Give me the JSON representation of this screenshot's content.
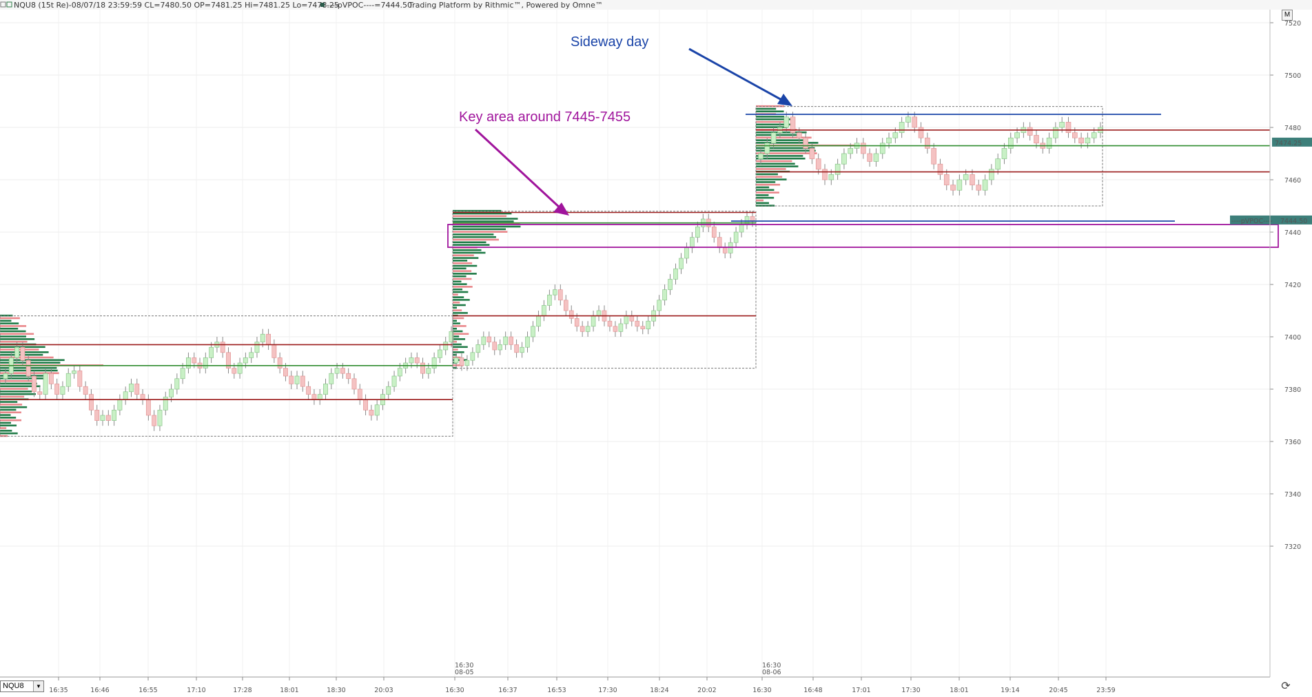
{
  "header": {
    "title": "NQU8 (15t Re)-08/07/18 23:59:59 CL=7480.50 OP=7481.25 Hi=7481.25 Lo=7478.25",
    "pvpoc_label": "----pVPOC----=7444.50",
    "platform": "Trading Platform by Rithmic™, Powered by Omne™"
  },
  "symbol_selector": {
    "value": "NQU8"
  },
  "m_button": "M",
  "annotations": {
    "sideway": "Sideway day",
    "key_area": "Key area around 7445-7455"
  },
  "price_tags": {
    "last": "7474.25",
    "pvpoc_text": "----pVPOC----",
    "pvpoc_value": "7444.50"
  },
  "time_axis": {
    "session_labels": [
      [
        "16:30",
        "08-05"
      ],
      [
        "16:30",
        "08-06"
      ]
    ]
  },
  "colors": {
    "bull": "#c9f0c6",
    "bear": "#f4c2c2",
    "volume_buy": "#1e7a46",
    "volume_sell": "#e9868a",
    "poc_line": "#2e8b2e",
    "value_area_line": "#9b1b1b",
    "annotation_blue": "#1a44a8",
    "annotation_purple": "#a0149c",
    "tag_bg": "#3d7f7a"
  },
  "chart_data": {
    "type": "candlestick",
    "instrument": "NQU8",
    "bar_type": "15t Re",
    "y_ticks": [
      7320,
      7340,
      7360,
      7380,
      7400,
      7420,
      7440,
      7460,
      7480,
      7500,
      7520
    ],
    "x_ticks": [
      "16:35",
      "16:46",
      "16:55",
      "17:10",
      "17:28",
      "18:01",
      "18:30",
      "20:03",
      "16:30",
      "16:37",
      "16:53",
      "17:30",
      "18:24",
      "20:02",
      "16:30",
      "16:48",
      "17:01",
      "17:30",
      "18:01",
      "19:14",
      "20:45",
      "23:59"
    ],
    "last_price": 7474.25,
    "pvpoc": 7444.5,
    "sessions": [
      {
        "price_range": [
          7362,
          7408
        ],
        "poc": 7389,
        "value_area": [
          7376,
          7397
        ],
        "closes": [
          7386,
          7392,
          7396,
          7391,
          7385,
          7379,
          7378,
          7386,
          7382,
          7378,
          7381,
          7386,
          7387,
          7381,
          7378,
          7372,
          7368,
          7370,
          7368,
          7372,
          7376,
          7379,
          7382,
          7378,
          7376,
          7370,
          7366,
          7372,
          7377,
          7380,
          7384,
          7388,
          7392,
          7390,
          7388,
          7392,
          7396,
          7398,
          7394,
          7388,
          7386,
          7390,
          7392,
          7394,
          7398,
          7401,
          7397,
          7392,
          7388,
          7385,
          7382,
          7385,
          7381,
          7378,
          7376,
          7378,
          7382,
          7386,
          7388,
          7386,
          7384,
          7380,
          7376,
          7372,
          7370,
          7374,
          7378,
          7381,
          7385,
          7388,
          7390,
          7392,
          7390,
          7386,
          7388,
          7392,
          7395,
          7398,
          7402
        ]
      },
      {
        "price_range": [
          7388,
          7448
        ],
        "poc": 7443.5,
        "value_area": [
          7408,
          7447.5
        ],
        "closes": [
          7392,
          7389,
          7391,
          7394,
          7397,
          7400,
          7398,
          7395,
          7397,
          7400,
          7397,
          7394,
          7396,
          7400,
          7404,
          7408,
          7412,
          7416,
          7418,
          7414,
          7410,
          7407,
          7404,
          7402,
          7404,
          7408,
          7410,
          7406,
          7404,
          7402,
          7405,
          7408,
          7406,
          7404,
          7403,
          7406,
          7410,
          7414,
          7418,
          7422,
          7426,
          7430,
          7434,
          7438,
          7442,
          7445,
          7442,
          7438,
          7434,
          7432,
          7436,
          7440,
          7443,
          7446,
          7444
        ]
      },
      {
        "price_range": [
          7450,
          7488
        ],
        "poc": 7473,
        "value_area": [
          7463,
          7479
        ],
        "closes": [
          7470,
          7474,
          7478,
          7480,
          7484,
          7478,
          7476,
          7472,
          7468,
          7464,
          7460,
          7462,
          7466,
          7470,
          7472,
          7474,
          7470,
          7467,
          7470,
          7474,
          7476,
          7478,
          7482,
          7484,
          7480,
          7476,
          7472,
          7466,
          7462,
          7458,
          7456,
          7460,
          7462,
          7458,
          7456,
          7460,
          7464,
          7468,
          7472,
          7476,
          7478,
          7480,
          7477,
          7474,
          7472,
          7476,
          7480,
          7482,
          7478,
          7476,
          7474,
          7476,
          7478,
          7480
        ]
      }
    ]
  }
}
